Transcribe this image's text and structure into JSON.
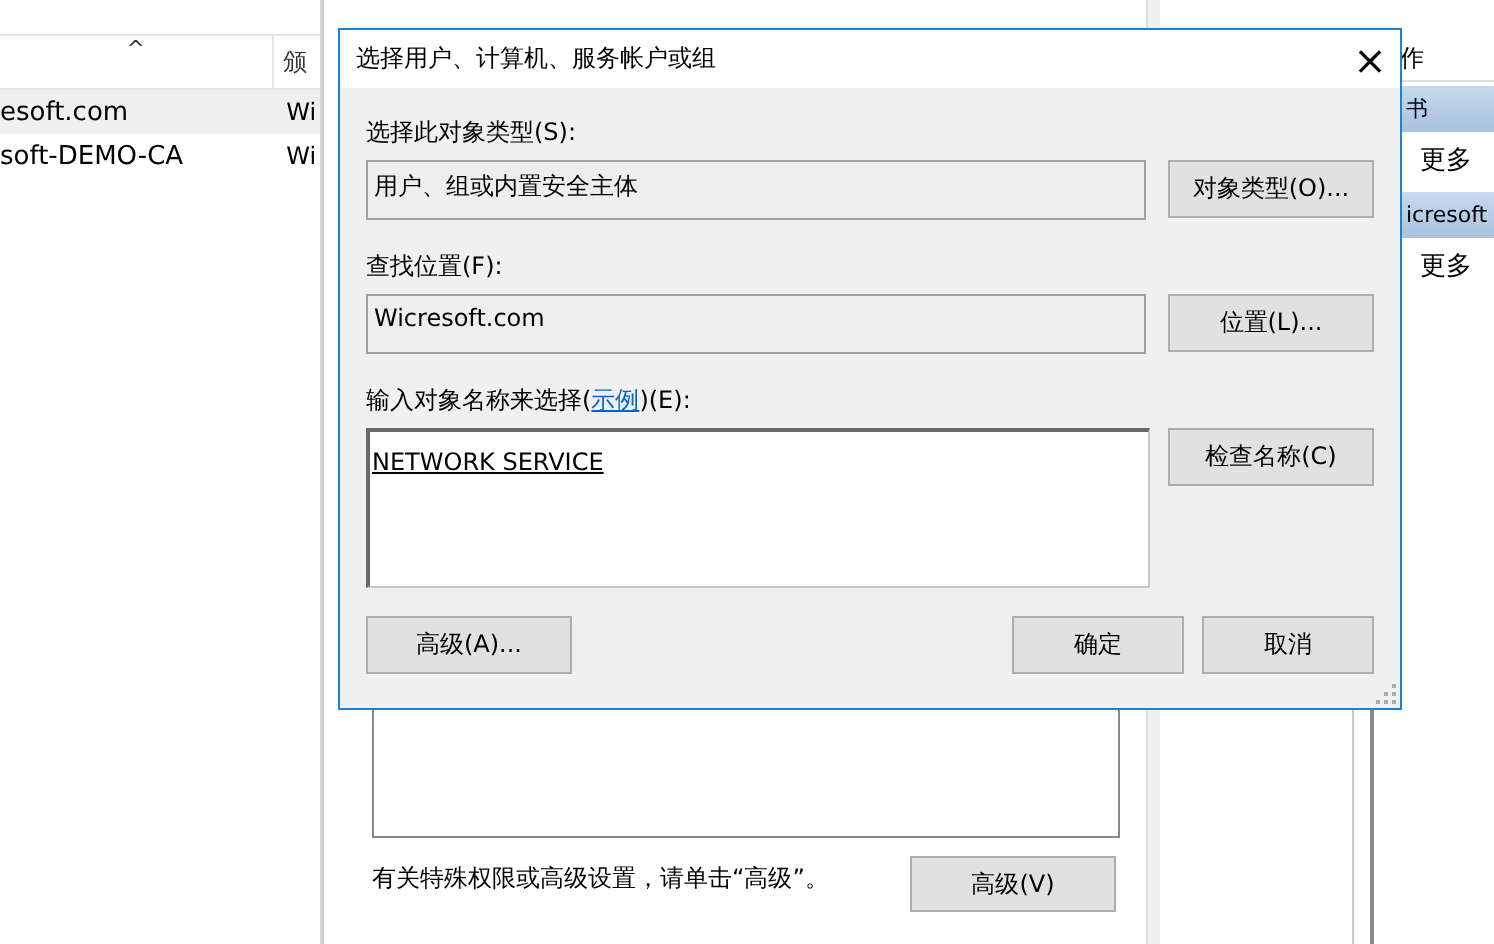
{
  "console": {
    "columns": [
      {
        "label": "^",
        "kind": "sort"
      },
      {
        "label": "颁"
      }
    ],
    "rows": [
      {
        "cells": [
          "esoft.com",
          "Wi"
        ],
        "selected": true
      },
      {
        "cells": [
          "soft-DEMO-CA",
          "Wi"
        ],
        "selected": false
      }
    ]
  },
  "permissions_dialog": {
    "note": "有关特殊权限或高级设置，请单击“高级”。",
    "advanced_button": "高级(V)"
  },
  "actions_pane": {
    "header": "作",
    "sections": [
      {
        "title": "书",
        "items": [
          "更多"
        ]
      },
      {
        "title": "icresoft",
        "items": [
          "更多"
        ]
      }
    ]
  },
  "dialog": {
    "title": "选择用户、计算机、服务帐户或组",
    "close": "×",
    "object_type": {
      "label": "选择此对象类型(S):",
      "value": "用户、组或内置安全主体",
      "button": "对象类型(O)..."
    },
    "location": {
      "label": "查找位置(F):",
      "value": "Wicresoft.com",
      "button": "位置(L)..."
    },
    "names": {
      "label_before": "输入对象名称来选择(",
      "link": "示例",
      "label_after": ")(E):",
      "value": "NETWORK SERVICE",
      "button": "检查名称(C)"
    },
    "buttons": [
      {
        "label": "高级(A)...",
        "kind": "left"
      },
      {
        "label": "确定",
        "kind": "right"
      },
      {
        "label": "取消",
        "kind": "right"
      }
    ]
  }
}
